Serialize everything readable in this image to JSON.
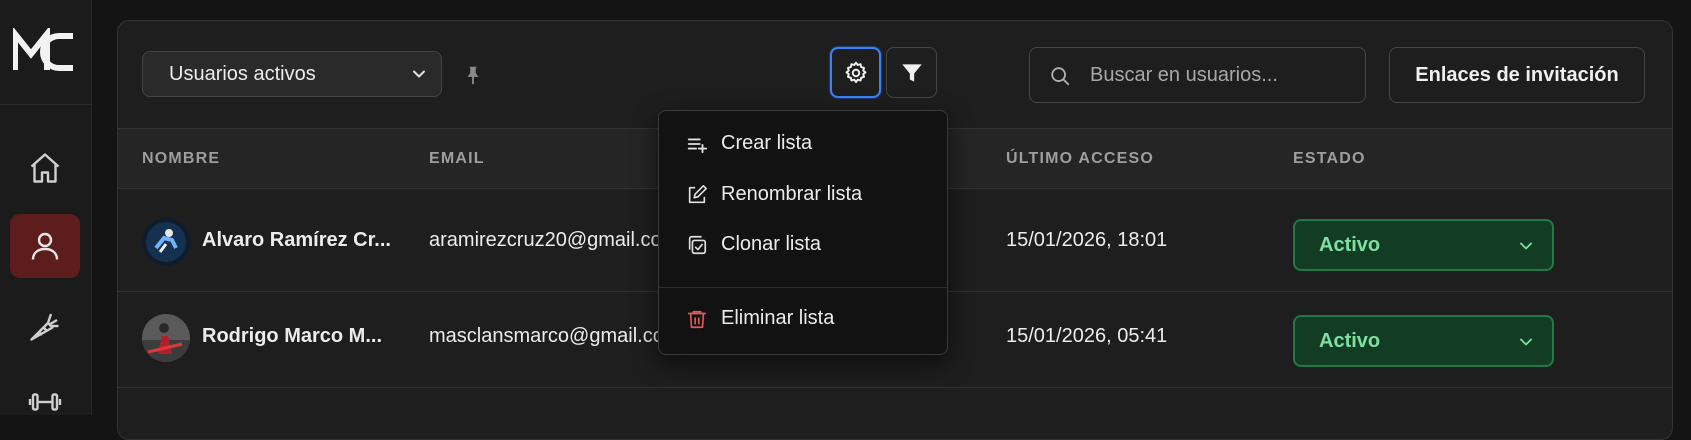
{
  "app": {
    "logo_text": "MC"
  },
  "sidebar": {
    "items": [
      {
        "icon": "home-icon",
        "active": false
      },
      {
        "icon": "user-icon",
        "active": true
      },
      {
        "icon": "carrot-icon",
        "active": false
      },
      {
        "icon": "dumbbell-icon",
        "active": false
      }
    ]
  },
  "toolbar": {
    "list_select": {
      "value": "Usuarios activos"
    },
    "search": {
      "placeholder": "Buscar en usuarios..."
    },
    "invite_label": "Enlaces de invitación"
  },
  "table": {
    "columns": [
      "NOMBRE",
      "EMAIL",
      "ÚLTIMO ACCESO",
      "ESTADO"
    ],
    "rows": [
      {
        "name": "Alvaro Ramírez Cr...",
        "email": "aramirezcruz20@gmail.com",
        "last_access": "15/01/2026, 18:01",
        "status": "Activo"
      },
      {
        "name": "Rodrigo Marco M...",
        "email": "masclansmarco@gmail.com",
        "last_access": "15/01/2026, 05:41",
        "status": "Activo"
      }
    ]
  },
  "menu": {
    "create": "Crear lista",
    "rename": "Renombrar lista",
    "clone": "Clonar lista",
    "delete": "Eliminar lista"
  },
  "colors": {
    "accent_focus": "#3b82f6",
    "active_nav": "#5e1d1d",
    "status_bg": "#123d24",
    "status_text": "#7ee0a0",
    "danger": "#e05a5a"
  }
}
